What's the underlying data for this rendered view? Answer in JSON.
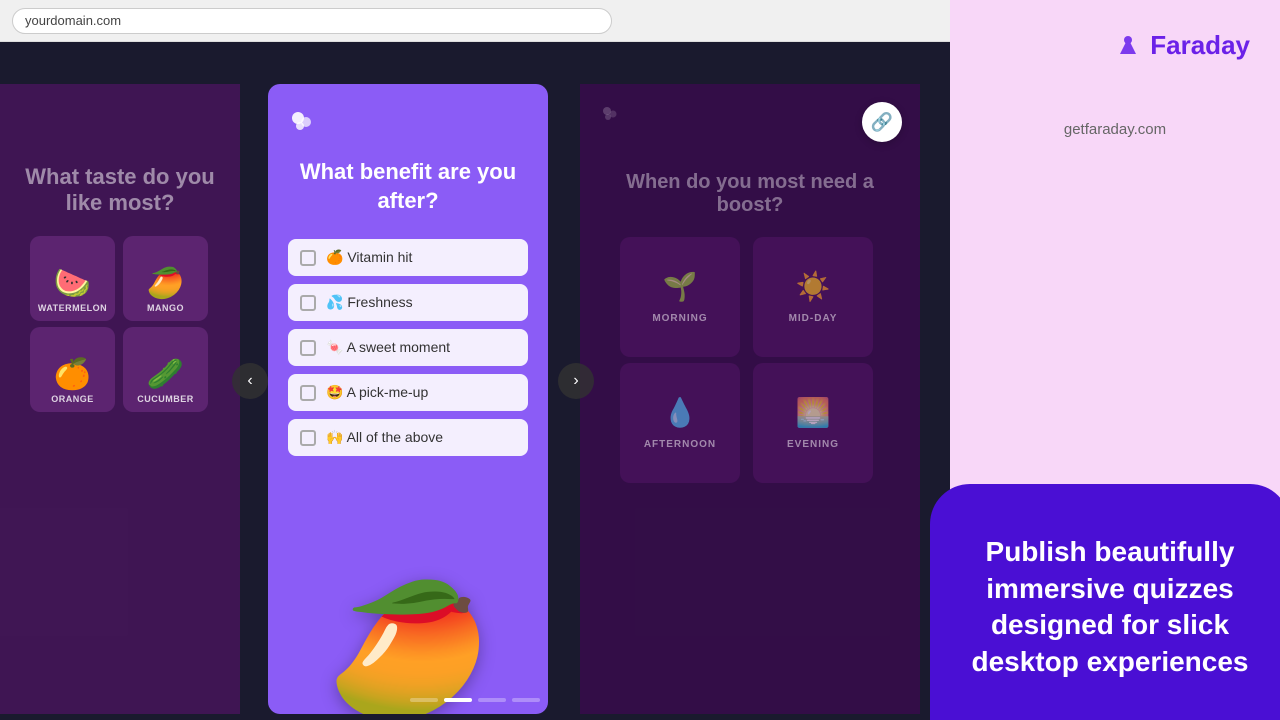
{
  "browser": {
    "url": "yourdomain.com"
  },
  "faraday": {
    "logo_text": "Faraday",
    "website": "getfaraday.com",
    "tagline": "Publish beautifully immersive quizzes designed for slick desktop experiences"
  },
  "left_card": {
    "title": "What taste do you like most?",
    "fruits": [
      {
        "emoji": "🍉",
        "label": "WATERMELON"
      },
      {
        "emoji": "🥭",
        "label": "MANGO"
      },
      {
        "emoji": "🍊",
        "label": "ORANGE"
      },
      {
        "emoji": "🥒",
        "label": "CUCUMBER"
      }
    ]
  },
  "center_card": {
    "logo": "🍃",
    "question": "What benefit are you after?",
    "options": [
      {
        "emoji": "🍊",
        "text": "Vitamin hit"
      },
      {
        "emoji": "💦",
        "text": "Freshness"
      },
      {
        "emoji": "🍬",
        "text": "A sweet moment"
      },
      {
        "emoji": "🤩",
        "text": "A pick-me-up"
      },
      {
        "emoji": "🙌",
        "text": "All of the above"
      }
    ]
  },
  "right_card": {
    "logo": "🍃",
    "title": "When do you most need a boost?",
    "time_slots": [
      {
        "icon": "🌱",
        "label": "MORNING"
      },
      {
        "icon": "☀️",
        "label": "MID-DAY"
      },
      {
        "icon": "💧",
        "label": "AFTERNOON"
      },
      {
        "icon": "🌅",
        "label": "EVENING"
      }
    ]
  },
  "pagination": {
    "dots": [
      false,
      true,
      false,
      false
    ]
  },
  "nav": {
    "left_arrow": "‹",
    "right_arrow": "›",
    "link_icon": "🔗"
  }
}
